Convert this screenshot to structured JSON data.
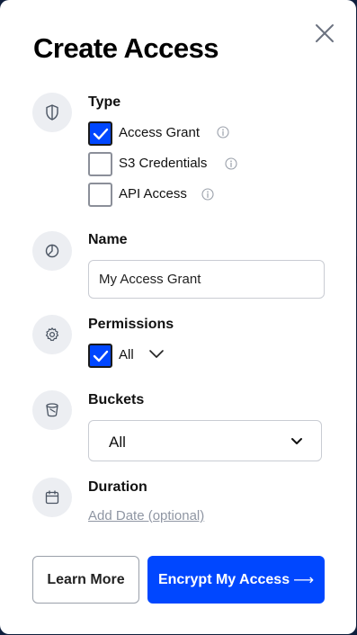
{
  "dialog": {
    "title": "Create Access",
    "close_icon": "close-icon"
  },
  "type_section": {
    "icon": "shield-icon",
    "label": "Type",
    "options": [
      {
        "label": "Access Grant",
        "checked": true,
        "info_icon": "info-icon"
      },
      {
        "label": "S3 Credentials",
        "checked": false,
        "info_icon": "info-icon"
      },
      {
        "label": "API Access",
        "checked": false,
        "info_icon": "info-icon"
      }
    ]
  },
  "name_section": {
    "icon": "pie-chart-icon",
    "label": "Name",
    "value": "My Access Grant"
  },
  "permissions_section": {
    "icon": "gear-icon",
    "label": "Permissions",
    "all_label": "All",
    "all_checked": true,
    "expand_icon": "chevron-down-icon"
  },
  "buckets_section": {
    "icon": "bucket-icon",
    "label": "Buckets",
    "selected": "All",
    "dropdown_icon": "chevron-down-icon"
  },
  "duration_section": {
    "icon": "calendar-icon",
    "label": "Duration",
    "link": "Add Date (optional)"
  },
  "footer": {
    "learn_more": "Learn More",
    "encrypt": "Encrypt My Access",
    "encrypt_arrow": "⟶"
  },
  "colors": {
    "primary": "#0047ff",
    "icon_bg": "#eceef2",
    "link": "#8f96a3"
  }
}
